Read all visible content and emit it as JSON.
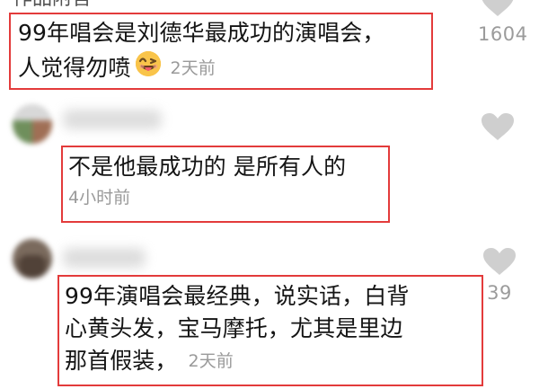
{
  "top_partial_text": "作品附言",
  "comments": [
    {
      "text_line1": "99年唱会是刘德华最成功的演唱会，",
      "text_line2": "人觉得勿喷",
      "emoji": "winking-tongue-out-face",
      "time": "2天前",
      "like_count": "1604",
      "box_color": "#e33b3b"
    },
    {
      "text": "不是他最成功的 是所有人的",
      "time": "4小时前",
      "like_count": "",
      "box_color": "#e33b3b"
    },
    {
      "text_line1": "99年演唱会最经典，说实话，白背",
      "text_line2": "心黄头发，宝马摩托，尤其是里边",
      "text_line3": "那首假装，",
      "time": "2天前",
      "like_count": "39",
      "box_color": "#e33b3b"
    }
  ],
  "icons": {
    "heart": "heart-icon",
    "emoji": "winking-tongue-out-face-icon"
  },
  "colors": {
    "highlight_border": "#e33b3b",
    "timestamp": "#9a9a9a",
    "heart": "#cfcfcf"
  }
}
